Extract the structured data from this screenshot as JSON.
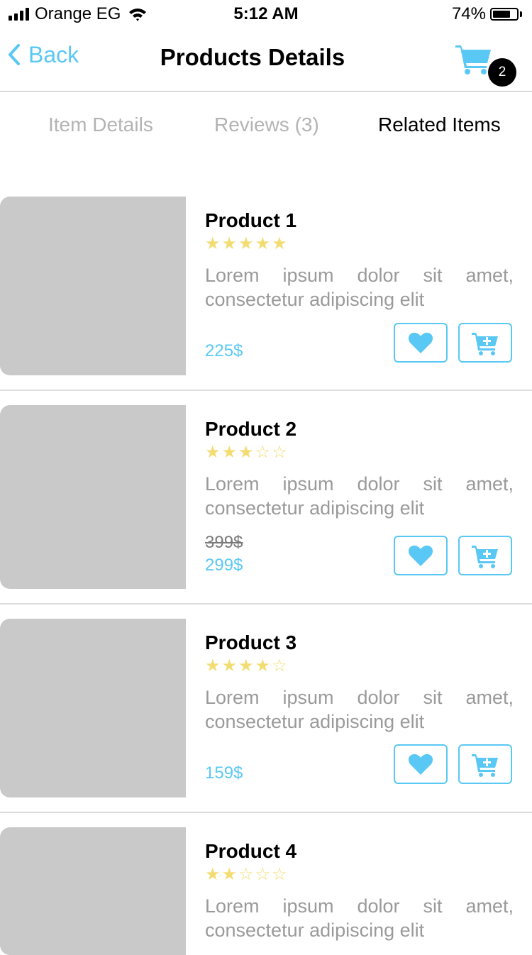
{
  "status_bar": {
    "carrier": "Orange EG",
    "time": "5:12 AM",
    "battery_percent": "74%",
    "battery_level": 0.74,
    "icons": [
      "signal-icon",
      "wifi-icon",
      "battery-icon"
    ]
  },
  "nav": {
    "back_label": "Back",
    "title": "Products Details",
    "cart_count": "2",
    "accent_color": "#5ac8f5"
  },
  "tabs": [
    {
      "label": "Item Details",
      "active": false
    },
    {
      "label": "Reviews (3)",
      "active": false
    },
    {
      "label": "Related Items",
      "active": true
    }
  ],
  "products": [
    {
      "name": "Product 1",
      "rating": 5,
      "stars": "★★★★★",
      "description": "Lorem ipsum dolor sit amet, consectetur adipiscing elit",
      "price": "225$",
      "old_price": ""
    },
    {
      "name": "Product 2",
      "rating": 3,
      "stars": "★★★☆☆",
      "description": "Lorem ipsum dolor sit amet, consectetur adipiscing elit",
      "price": "299$",
      "old_price": "399$"
    },
    {
      "name": "Product 3",
      "rating": 4,
      "stars": "★★★★☆",
      "description": "Lorem ipsum dolor sit amet, consectetur adipiscing elit",
      "price": "159$",
      "old_price": ""
    },
    {
      "name": "Product 4",
      "rating": 2,
      "stars": "★★☆☆☆",
      "description": "Lorem ipsum dolor sit amet, consectetur adipiscing elit",
      "price": "",
      "old_price": ""
    }
  ],
  "colors": {
    "accent": "#5ac8f5",
    "star": "#f3dc72",
    "image_placeholder": "#c9c9c9"
  }
}
